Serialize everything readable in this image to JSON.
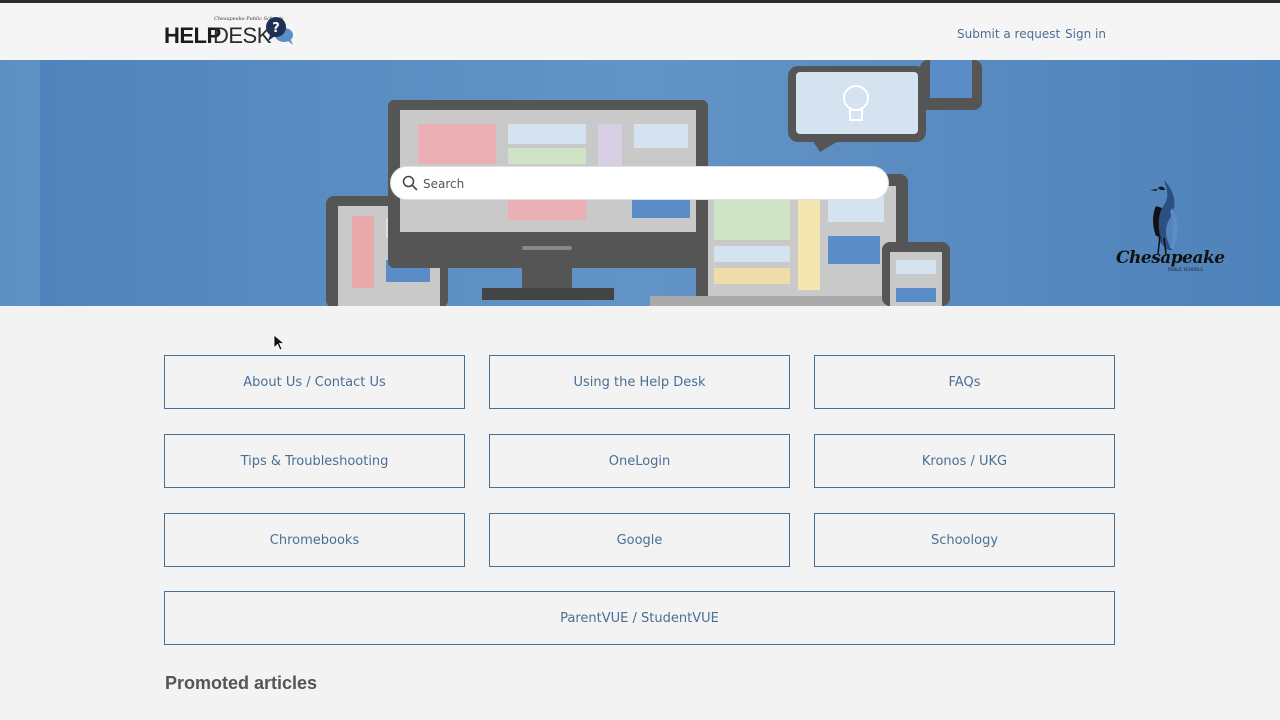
{
  "header": {
    "logo_help": "HELP",
    "logo_desk": "DESK",
    "logo_tagline": "Chesapeake Public Schools",
    "submit_request": "Submit a request",
    "sign_in": "Sign in"
  },
  "search": {
    "placeholder": "Search"
  },
  "brand": {
    "name": "Chesapeake",
    "sub": "PUBLIC SCHOOLS"
  },
  "categories": [
    "About Us / Contact Us",
    "Using the Help Desk",
    "FAQs",
    "Tips & Troubleshooting",
    "OneLogin",
    "Kronos / UKG",
    "Chromebooks",
    "Google",
    "Schoology",
    "ParentVUE / StudentVUE"
  ],
  "promoted_heading": "Promoted articles",
  "colors": {
    "accent": "#4a6f94",
    "hero_bg": "#5a8cc0",
    "page_bg": "#f3f3f3"
  }
}
